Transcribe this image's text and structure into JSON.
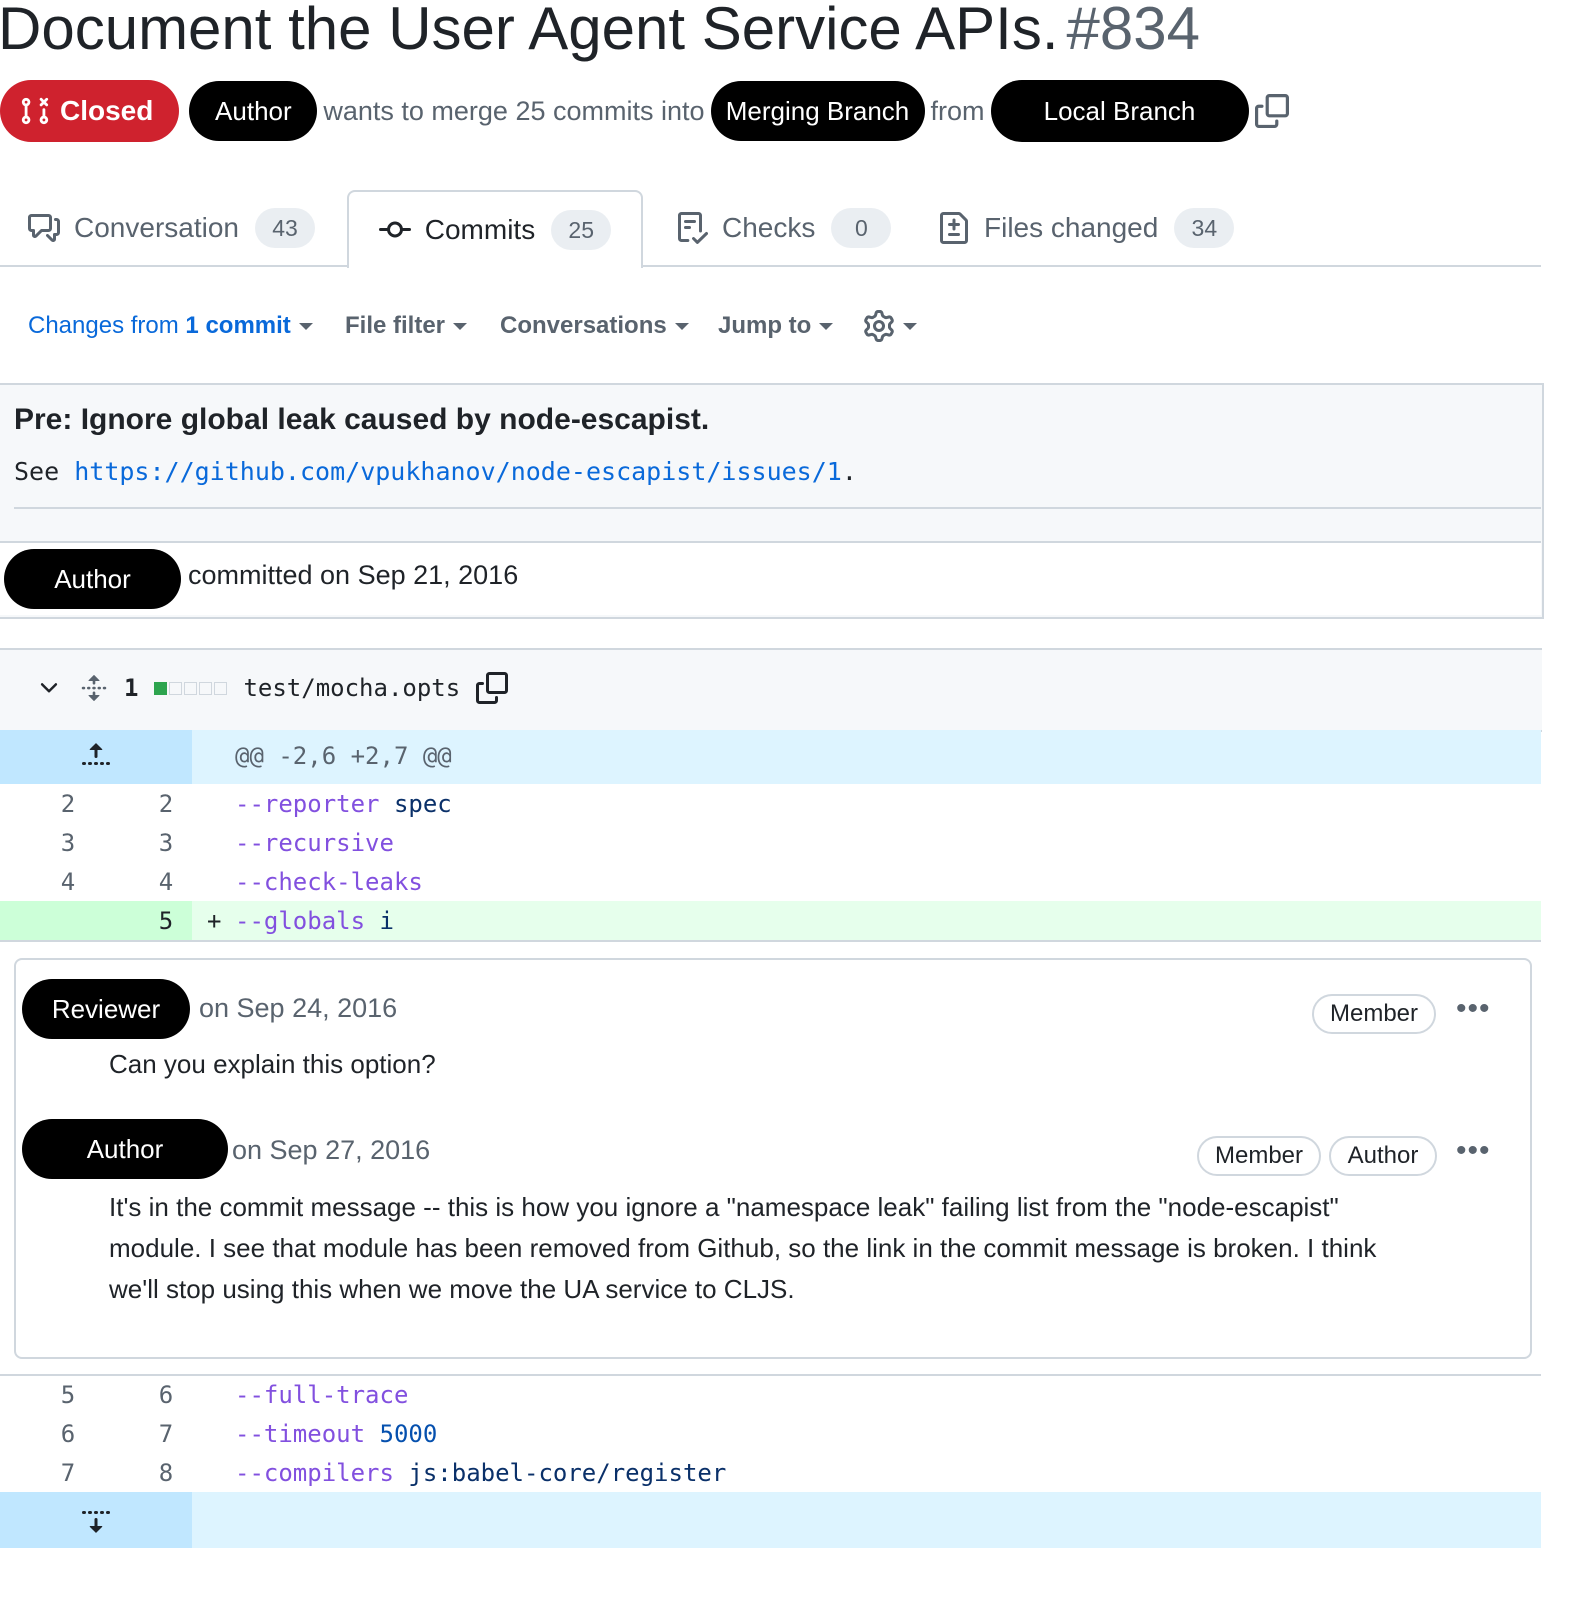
{
  "pr": {
    "title": "Document the User Agent Service APIs.",
    "number": "#834",
    "state": "Closed",
    "author": "Author",
    "merge_text": "wants to merge 25 commits into",
    "base_branch": "Merging Branch",
    "from_text": "from",
    "head_branch": "Local Branch"
  },
  "tabs": [
    {
      "label": "Conversation",
      "count": "43",
      "icon": "comment-discussion-icon"
    },
    {
      "label": "Commits",
      "count": "25",
      "icon": "git-commit-icon"
    },
    {
      "label": "Checks",
      "count": "0",
      "icon": "checklist-icon"
    },
    {
      "label": "Files changed",
      "count": "34",
      "icon": "file-diff-icon"
    }
  ],
  "toolbar": {
    "changes_prefix": "Changes from",
    "changes_bold": "1 commit",
    "file_filter": "File filter",
    "conversations": "Conversations",
    "jump_to": "Jump to"
  },
  "commit": {
    "title": "Pre: Ignore global leak caused by node-escapist.",
    "desc_prefix": "See",
    "link": "https://github.com/vpukhanov/node-escapist/issues/1",
    "desc_suffix": ".",
    "author": "Author",
    "committed": "committed on Sep 21, 2016"
  },
  "file": {
    "changes": "1",
    "path": "test/mocha.opts"
  },
  "diff": {
    "hunk": "@@ -2,6 +2,7 @@",
    "lines_before": [
      {
        "old": "2",
        "new": "2",
        "flag": "--reporter",
        "value": "spec"
      },
      {
        "old": "3",
        "new": "3",
        "flag": "--recursive",
        "value": ""
      },
      {
        "old": "4",
        "new": "4",
        "flag": "--check-leaks",
        "value": ""
      }
    ],
    "added": {
      "old": "",
      "new": "5",
      "sign": "+",
      "flag": "--globals",
      "value": "i"
    },
    "lines_after": [
      {
        "old": "5",
        "new": "6",
        "flag": "--full-trace",
        "value": ""
      },
      {
        "old": "6",
        "new": "7",
        "flag": "--timeout",
        "value": "5000"
      },
      {
        "old": "7",
        "new": "8",
        "flag": "--compilers",
        "value": "js:babel-core/register"
      }
    ]
  },
  "comments": [
    {
      "author": "Reviewer",
      "date": "on Sep 24, 2016",
      "badges": [
        "Member"
      ],
      "body": "Can you explain this option?"
    },
    {
      "author": "Author",
      "date": "on Sep 27, 2016",
      "badges": [
        "Member",
        "Author"
      ],
      "body_lines": [
        "It's in the commit message -- this is how you ignore a \"namespace leak\" failing list from the \"node-escapist\"",
        "module. I see that module has been removed from Github, so the link in the commit message is broken. I think",
        "we'll stop using this when we move the UA service to CLJS."
      ]
    }
  ],
  "colors": {
    "closed": "#cf222e",
    "link": "#0969da",
    "hunk_bg": "#ddf4ff",
    "added_bg": "#e6ffec",
    "keyword": "#8250df"
  }
}
